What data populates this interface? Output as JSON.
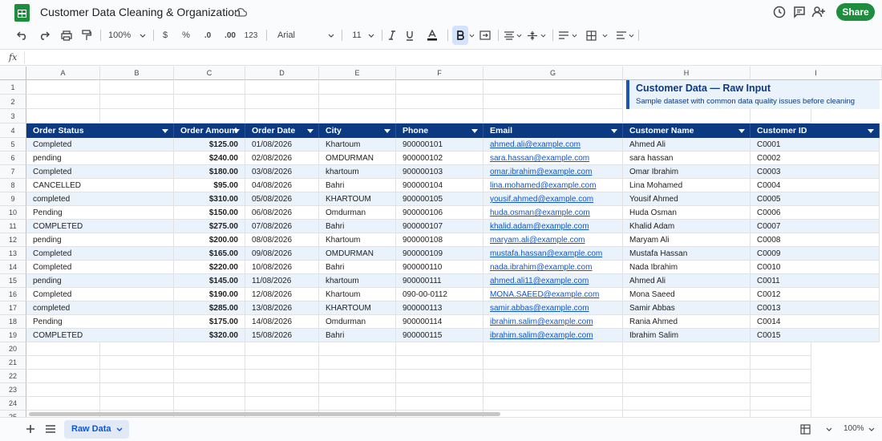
{
  "app": {
    "doc_title": "Customer Data Cleaning & Organization",
    "share_label": "Share"
  },
  "toolbar": {
    "zoom": "100%",
    "currency": "$",
    "percent": "%",
    "dec_less": ".0",
    "dec_more": ".00",
    "number_format": "123",
    "font": "Arial",
    "font_size": "11"
  },
  "formula": {
    "fx": "fx"
  },
  "grid": {
    "columns": [
      "A",
      "B",
      "C",
      "D",
      "E",
      "F",
      "G",
      "H",
      "I"
    ],
    "rows": [
      "1",
      "2",
      "3",
      "4",
      "5",
      "6",
      "7",
      "8",
      "9",
      "10",
      "11",
      "12",
      "13",
      "14",
      "15",
      "16",
      "17",
      "18",
      "19",
      "20",
      "21",
      "22",
      "23",
      "24",
      "25"
    ]
  },
  "note": {
    "title": "Customer Data — Raw Input",
    "subtitle": "Sample dataset with common data quality issues before cleaning"
  },
  "table": {
    "headers": [
      "Order Status",
      "Order Amount",
      "Order Date",
      "City",
      "Phone",
      "Email",
      "Customer Name",
      "Customer ID"
    ],
    "rows": [
      [
        "Completed",
        "$125.00",
        "01/08/2026",
        "Khartoum",
        "900000101",
        "ahmed.ali@example.com",
        "Ahmed Ali",
        "C0001"
      ],
      [
        "pending",
        "$240.00",
        "02/08/2026",
        "OMDURMAN",
        "900000102",
        "sara.hassan@example.com",
        "sara hassan",
        "C0002"
      ],
      [
        "Completed",
        "$180.00",
        "03/08/2026",
        "khartoum",
        "900000103",
        "omar.ibrahim@example.com",
        "Omar Ibrahim",
        "C0003"
      ],
      [
        "CANCELLED",
        "$95.00",
        "04/08/2026",
        "Bahri",
        "900000104",
        "lina.mohamed@example.com",
        "Lina Mohamed",
        "C0004"
      ],
      [
        "completed",
        "$310.00",
        "05/08/2026",
        "KHARTOUM",
        "900000105",
        "yousif.ahmed@example.com",
        "Yousif Ahmed",
        "C0005"
      ],
      [
        "Pending",
        "$150.00",
        "06/08/2026",
        "Omdurman",
        "900000106",
        "huda.osman@example.com",
        "Huda Osman",
        "C0006"
      ],
      [
        "COMPLETED",
        "$275.00",
        "07/08/2026",
        "Bahri",
        "900000107",
        "khalid.adam@example.com",
        "Khalid Adam",
        "C0007"
      ],
      [
        "pending",
        "$200.00",
        "08/08/2026",
        "Khartoum",
        "900000108",
        "maryam.ali@example.com",
        "Maryam Ali",
        "C0008"
      ],
      [
        "Completed",
        "$165.00",
        "09/08/2026",
        "OMDURMAN",
        "900000109",
        "mustafa.hassan@example.com",
        "Mustafa Hassan",
        "C0009"
      ],
      [
        "Completed",
        "$220.00",
        "10/08/2026",
        "Bahri",
        "900000110",
        "nada.ibrahim@example.com",
        "Nada Ibrahim",
        "C0010"
      ],
      [
        "pending",
        "$145.00",
        "11/08/2026",
        "khartoum",
        "900000111",
        "ahmed.ali11@example.com",
        "Ahmed Ali",
        "C0011"
      ],
      [
        "Completed",
        "$190.00",
        "12/08/2026",
        "Khartoum",
        "090-00-0112",
        "MONA.SAEED@example.com",
        "Mona Saeed",
        "C0012"
      ],
      [
        "completed",
        "$285.00",
        "13/08/2026",
        "KHARTOUM",
        "900000113",
        "samir.abbas@example.com",
        "Samir Abbas",
        "C0013"
      ],
      [
        "Pending",
        "$175.00",
        "14/08/2026",
        "Omdurman",
        "900000114",
        "ibrahim.salim@example.com",
        "Rania Ahmed",
        "C0014"
      ],
      [
        "COMPLETED",
        "$320.00",
        "15/08/2026",
        "Bahri",
        "900000115",
        "ibrahim.salim@example.com",
        "Ibrahim Salim",
        "C0015"
      ]
    ]
  },
  "bottom": {
    "sheet_tab": "Raw Data",
    "zoom": "100%"
  },
  "colors": {
    "header_bg": "#0b3a82",
    "band": "#eaf2fb",
    "link": "#1155cc",
    "share": "#1e8e3e"
  }
}
